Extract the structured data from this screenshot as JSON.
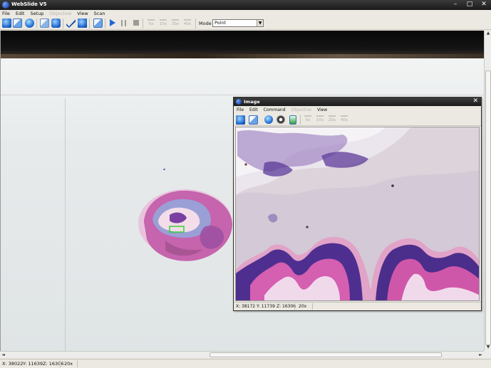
{
  "window": {
    "title": "WebSlide V5",
    "minimize": "–",
    "maximize": "□",
    "close": "✕"
  },
  "menu": {
    "items": [
      "File",
      "Edit",
      "Setup",
      "Objective",
      "View",
      "Scan"
    ],
    "disabled": [
      "Objective"
    ]
  },
  "toolbar": {
    "zoom_buttons": [
      "5x",
      "10x",
      "20x",
      "40x"
    ],
    "mode_label": "Mode",
    "mode_value": "Point",
    "mode_arrow": "▼"
  },
  "status": {
    "x": "X: 38022",
    "y": "Y: 11639",
    "z": "Z: 16306",
    "magnification": "20x"
  },
  "scroll": {
    "up": "▲",
    "down": "▼",
    "left": "◄",
    "right": "►"
  },
  "image_window": {
    "title": "Image",
    "close": "✕",
    "menu": [
      "File",
      "Edit",
      "Command",
      "Objective",
      "View"
    ],
    "disabled": [
      "Objective"
    ],
    "zoom_buttons": [
      "5x",
      "10x",
      "20x",
      "40x"
    ],
    "status": {
      "x": "X: 38172",
      "y": "Y: 11739",
      "z": "Z: 16306",
      "magnification": "20x"
    }
  },
  "colors": {
    "accent_blue": "#1f66d6",
    "tissue_pink": "#c35ea6",
    "tissue_purple": "#4b2e8c",
    "background": "#e7ebec"
  },
  "icons": [
    "open-icon",
    "save-slide-icon",
    "globe-icon",
    "copy-icon",
    "layers-icon",
    "check-icon",
    "export-icon",
    "stack-icon",
    "play-icon",
    "pause-icon",
    "stop-icon",
    "zoom-icon",
    "settings-icon",
    "report-icon"
  ]
}
